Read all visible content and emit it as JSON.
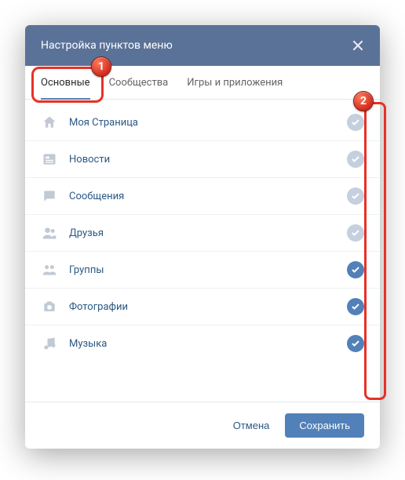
{
  "header": {
    "title": "Настройка пунктов меню"
  },
  "tabs": [
    {
      "label": "Основные",
      "active": true
    },
    {
      "label": "Сообщества",
      "active": false
    },
    {
      "label": "Игры и приложения",
      "active": false
    }
  ],
  "items": [
    {
      "icon": "home",
      "label": "Моя Страница",
      "enabled": false
    },
    {
      "icon": "news",
      "label": "Новости",
      "enabled": false
    },
    {
      "icon": "messages",
      "label": "Сообщения",
      "enabled": false
    },
    {
      "icon": "friends",
      "label": "Друзья",
      "enabled": false
    },
    {
      "icon": "groups",
      "label": "Группы",
      "enabled": true
    },
    {
      "icon": "photos",
      "label": "Фотографии",
      "enabled": true
    },
    {
      "icon": "music",
      "label": "Музыка",
      "enabled": true
    }
  ],
  "footer": {
    "cancel": "Отмена",
    "save": "Сохранить"
  },
  "annotations": {
    "badge1": "1",
    "badge2": "2"
  },
  "colors": {
    "header_bg": "#5b7298",
    "accent": "#5181b8",
    "link": "#2a5885",
    "callout": "#e53228"
  }
}
